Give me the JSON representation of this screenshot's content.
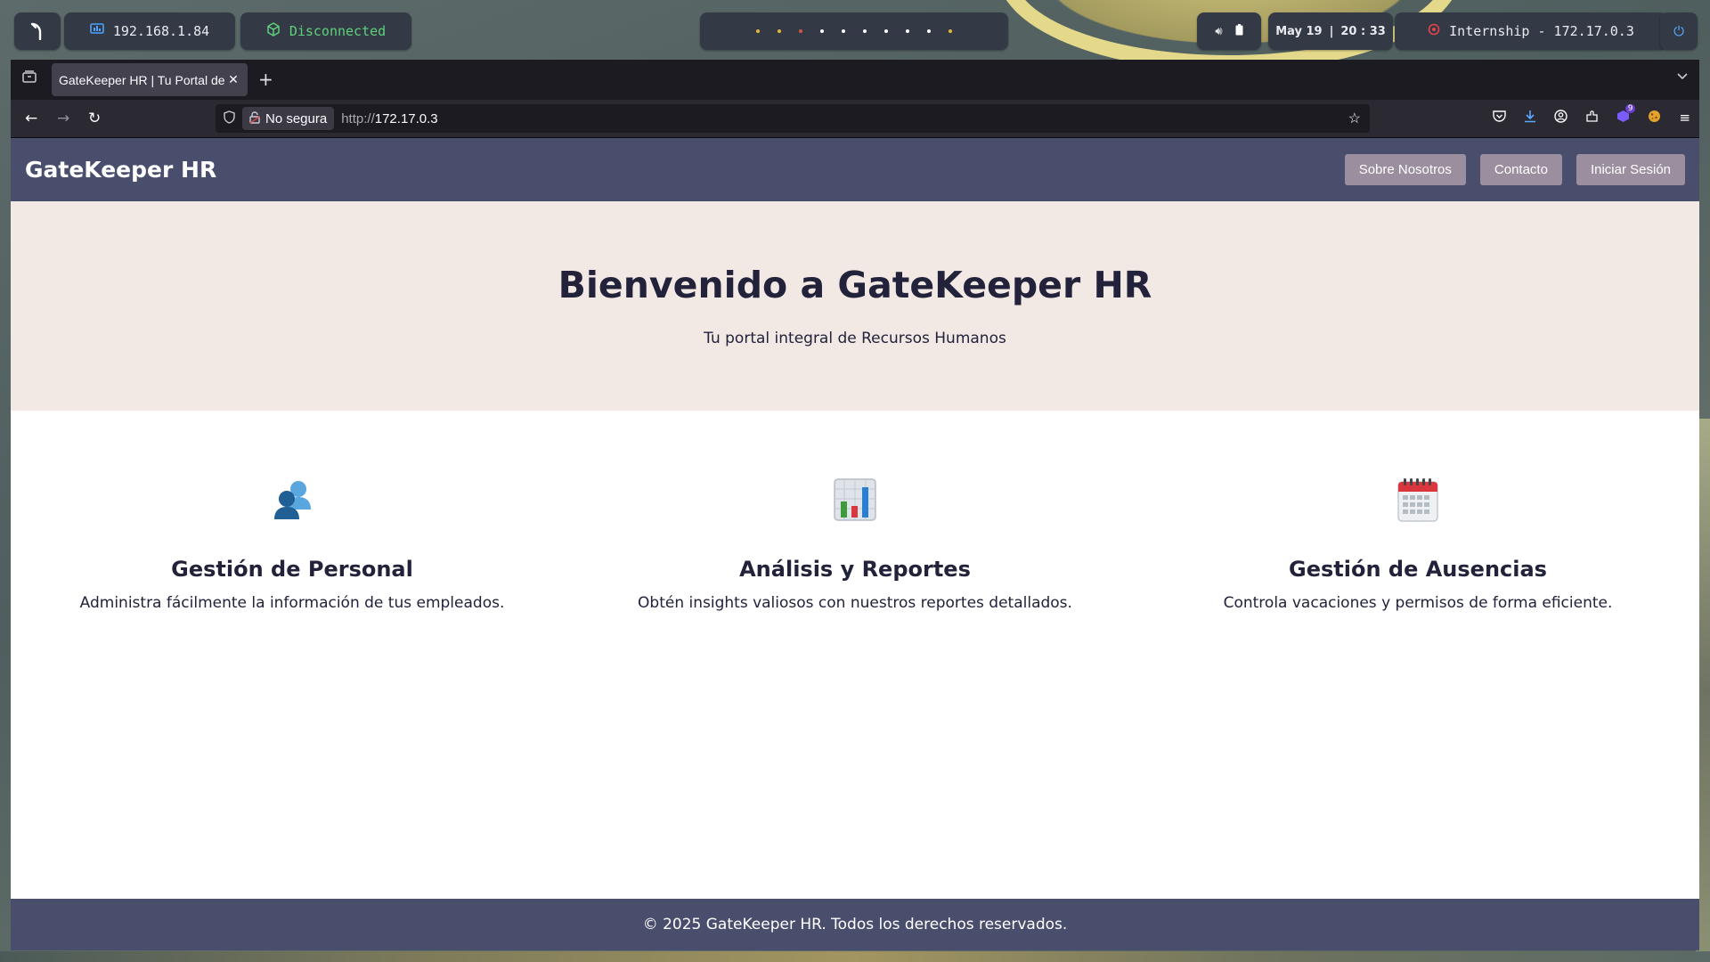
{
  "system_bar": {
    "logo_icon": "kali-dragon-icon",
    "local_ip": "192.168.1.84",
    "vpn_status": "Disconnected",
    "workspaces": [
      "y",
      "y",
      "r",
      "w",
      "w",
      "w",
      "w",
      "w",
      "w",
      "y"
    ],
    "date": "May 19",
    "time": "20 : 33",
    "target": "Internship - 172.17.0.3"
  },
  "browser": {
    "tab_title": "GateKeeper HR | Tu Portal de",
    "security_label": "No segura",
    "url_protocol": "http://",
    "url_host": "172.17.0.3",
    "extension_badge": "9"
  },
  "site": {
    "brand": "GateKeeper HR",
    "nav": [
      "Sobre Nosotros",
      "Contacto",
      "Iniciar Sesión"
    ],
    "hero": {
      "title": "Bienvenido a GateKeeper HR",
      "subtitle": "Tu portal integral de Recursos Humanos"
    },
    "features": [
      {
        "icon": "people-icon",
        "title": "Gestión de Personal",
        "text": "Administra fácilmente la información de tus empleados."
      },
      {
        "icon": "bar-chart-icon",
        "title": "Análisis y Reportes",
        "text": "Obtén insights valiosos con nuestros reportes detallados."
      },
      {
        "icon": "calendar-icon",
        "title": "Gestión de Ausencias",
        "text": "Controla vacaciones y permisos de forma eficiente."
      }
    ],
    "footer": "© 2025 GateKeeper HR. Todos los derechos reservados."
  },
  "colors": {
    "header_bg": "#4a4e6d",
    "hero_bg": "#f2e8e4",
    "nav_button_bg": "#9b8e9e",
    "text_dark": "#22223b",
    "vpn_disconnected": "#5fd07a"
  }
}
